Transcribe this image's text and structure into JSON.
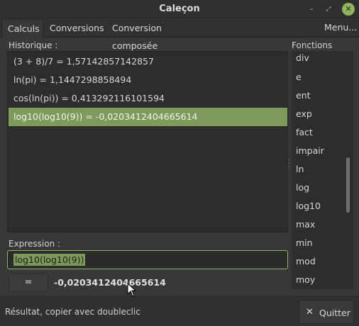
{
  "window": {
    "title": "Caleçon"
  },
  "tabs": [
    "Calculs",
    "Conversions",
    "Conversion composée"
  ],
  "menu_label": "Menu...",
  "history": {
    "label": "Historique :",
    "rows": [
      "(3 + 8)/7 = 1,57142857142857",
      "ln(pi) = 1,1447298858494",
      "cos(ln(pi)) = 0,413292116101594",
      "log10(log10(9)) = -0,0203412404665614"
    ]
  },
  "functions": {
    "label": "Fonctions",
    "items": [
      "div",
      "e",
      "ent",
      "exp",
      "fact",
      "impair",
      "ln",
      "log",
      "log10",
      "max",
      "min",
      "mod",
      "moy"
    ]
  },
  "expression": {
    "label": "Expression :",
    "value": "log10(log10(9))"
  },
  "equals_label": "=",
  "result": "-0,0203412404665614",
  "status": "Résultat, copier avec doubleclic",
  "quit_label": "Quitter",
  "accent_color": "#8fb45a",
  "selection_color": "#7d9a5a"
}
